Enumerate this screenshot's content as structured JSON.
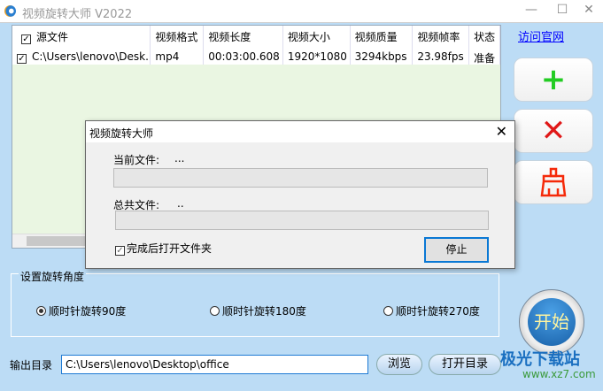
{
  "window": {
    "title": "视频旋转大师 V2022",
    "minimize": "—",
    "maximize": "☐",
    "close": "✕"
  },
  "table": {
    "headers": [
      "源文件",
      "视频格式",
      "视频长度",
      "视频大小",
      "视频质量",
      "视频帧率",
      "状态"
    ],
    "rows": [
      {
        "checked": true,
        "cells": [
          "C:\\Users\\lenovo\\Desk...",
          "mp4",
          "00:03:00.608",
          "1920*1080",
          "3294kbps",
          "23.98fps",
          "准备"
        ]
      }
    ]
  },
  "sidebar": {
    "link": "访问官网",
    "add": "+",
    "remove": "✕",
    "clear": "clear"
  },
  "rotation": {
    "legend": "设置旋转角度",
    "options": [
      "顺时针旋转90度",
      "顺时针旋转180度",
      "顺时针旋转270度"
    ],
    "selected": 0
  },
  "output": {
    "label": "输出目录",
    "value": "C:\\Users\\lenovo\\Desktop\\office",
    "browse": "浏览",
    "open": "打开目录"
  },
  "start": "开始",
  "watermark": {
    "name": "极光下载站",
    "url": "www.xz7.com"
  },
  "dialog": {
    "title": "视频旋转大师",
    "current_label": "当前文件:",
    "current_value": "...",
    "total_label": "总共文件:",
    "total_value": "..",
    "current_progress": 0,
    "total_progress": 0,
    "open_after": "完成后打开文件夹",
    "open_after_checked": true,
    "stop": "停止",
    "close": "✕"
  }
}
